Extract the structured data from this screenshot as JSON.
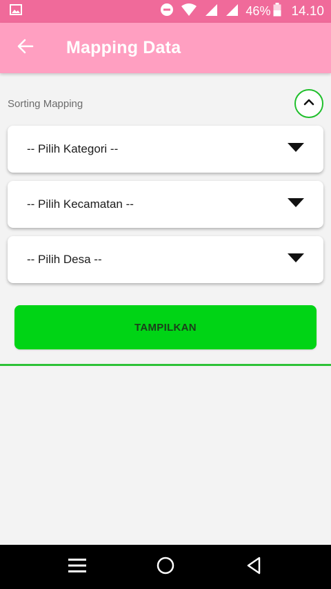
{
  "status_bar": {
    "battery": "46%",
    "time": "14.10"
  },
  "app_bar": {
    "title": "Mapping Data"
  },
  "sorting": {
    "label": "Sorting Mapping"
  },
  "dropdowns": [
    {
      "label": "-- Pilih Kategori --"
    },
    {
      "label": "-- Pilih Kecamatan --"
    },
    {
      "label": "-- Pilih Desa --"
    }
  ],
  "button": {
    "label": "TAMPILKAN"
  },
  "colors": {
    "status_bar": "#f06a9a",
    "app_bar": "#ff9fc1",
    "accent_green": "#00d415",
    "divider_green": "#2dc236"
  },
  "icons": {
    "status": [
      "image-icon",
      "do-not-disturb-icon",
      "wifi-icon",
      "signal-icon",
      "signal-icon",
      "battery-icon"
    ],
    "nav": [
      "menu-icon",
      "home-icon",
      "back-icon"
    ]
  }
}
